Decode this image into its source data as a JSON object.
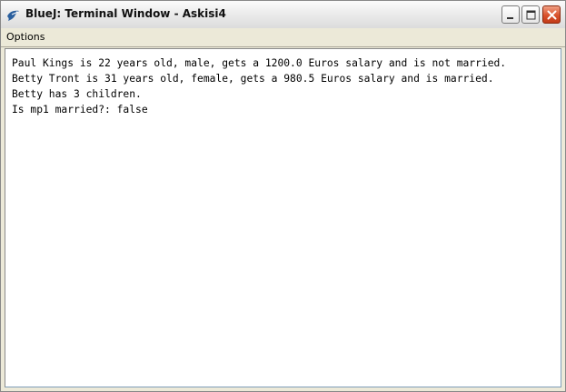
{
  "window": {
    "title": "BlueJ: Terminal Window - Askisi4",
    "icon": "bluej-bird-icon"
  },
  "menubar": {
    "items": [
      {
        "label": "Options"
      }
    ]
  },
  "terminal": {
    "lines": [
      "Paul Kings is 22 years old, male, gets a 1200.0 Euros salary and is not married.",
      "Betty Tront is 31 years old, female, gets a 980.5 Euros salary and is married.",
      "Betty has 3 children.",
      "Is mp1 married?: false"
    ]
  },
  "colors": {
    "close_button": "#d9522c",
    "terminal_background": "#ffffff",
    "chrome_background": "#ece9d8"
  }
}
